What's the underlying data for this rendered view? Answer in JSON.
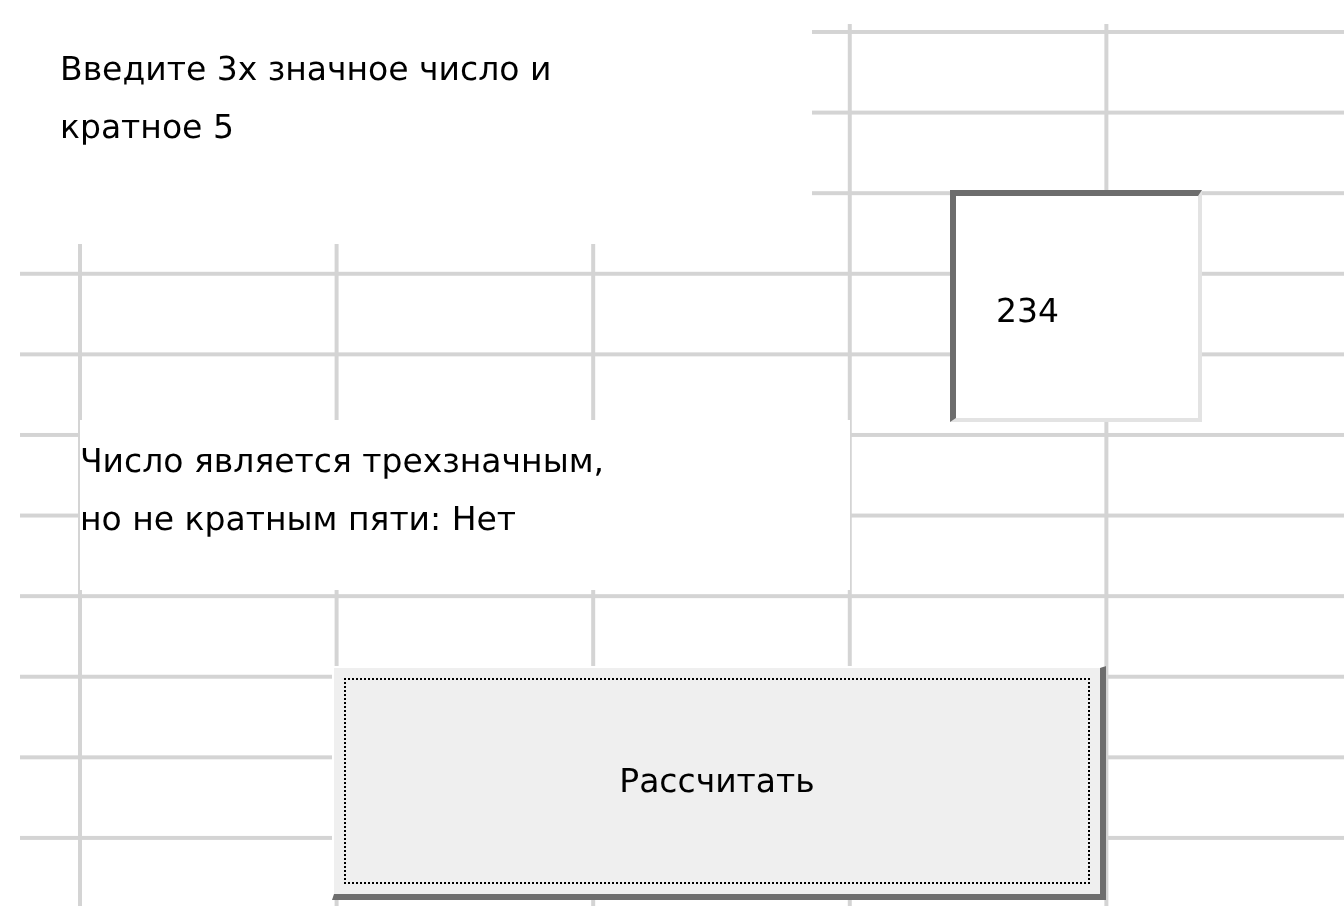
{
  "prompt_label": {
    "lines": [
      "Введите 3х значное число и",
      "кратное 5"
    ]
  },
  "number_field": {
    "value": "234"
  },
  "result_label": {
    "lines": [
      "Число является трехзначным,",
      "но не кратным пяти: Нет"
    ]
  },
  "calculate_button": {
    "label": "Рассчитать",
    "focused": true
  }
}
